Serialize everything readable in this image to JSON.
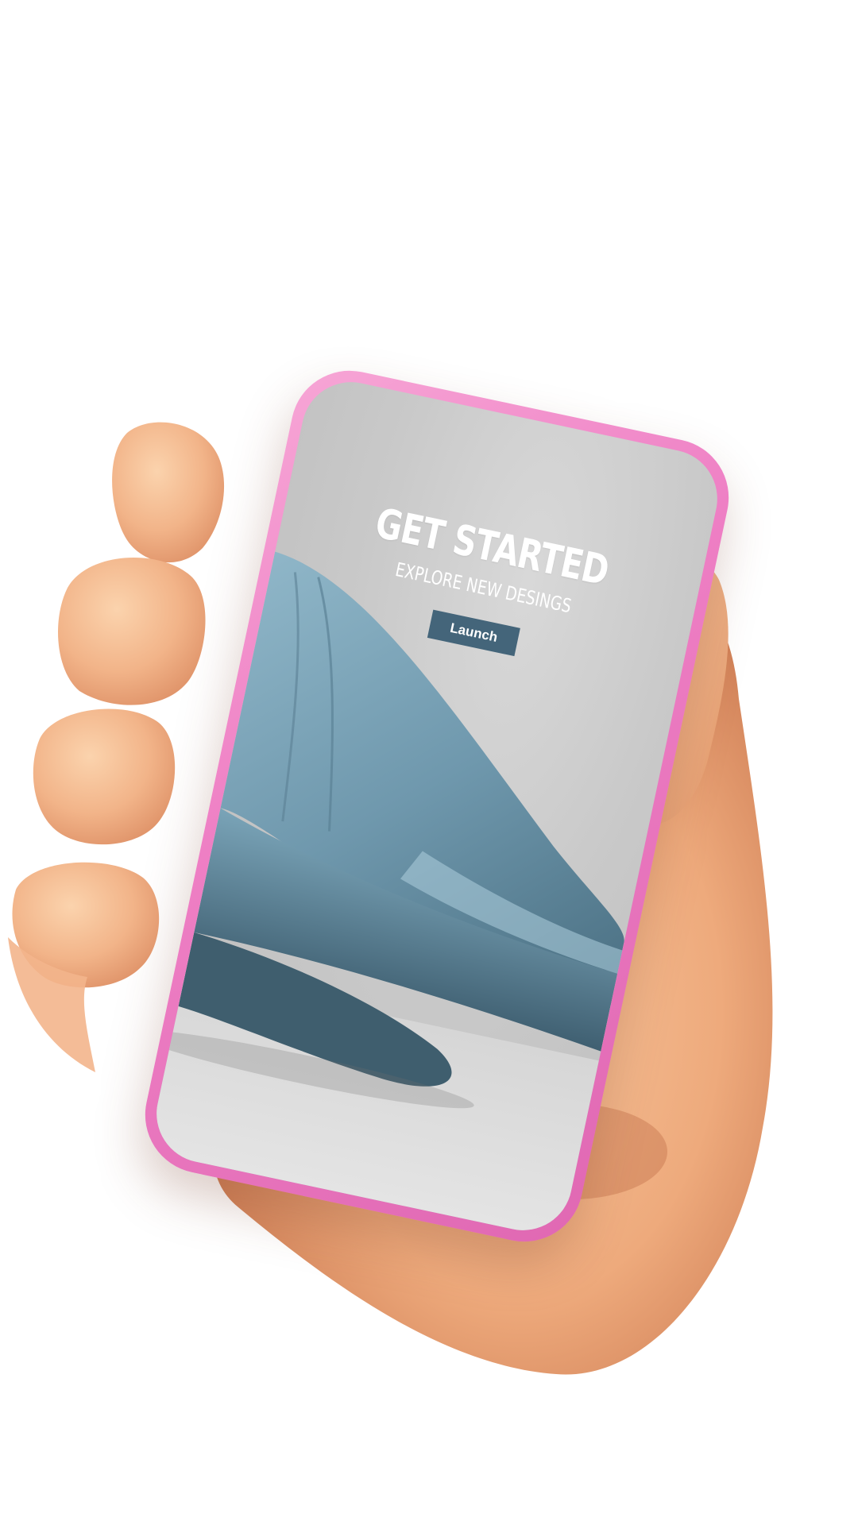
{
  "screen": {
    "headline": "GET STARTED",
    "subline": "EXPLORE NEW DESINGS",
    "launch_label": "Launch"
  },
  "colors": {
    "phone_frame": "#ee7fc4",
    "button_bg": "#44657a",
    "chair": "#6f98ad",
    "skin": "#f1b58d"
  }
}
